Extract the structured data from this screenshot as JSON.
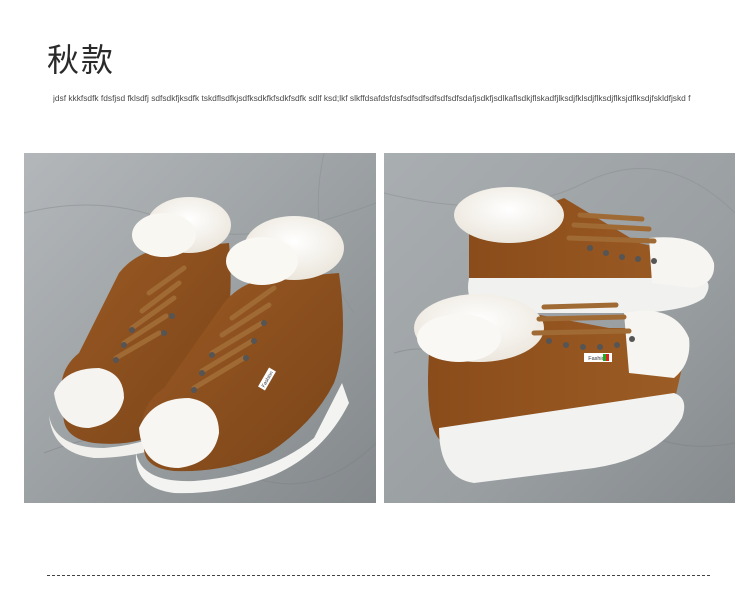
{
  "header": {
    "title": "秋款",
    "subtitle": "jdsf kkkfsdfk  fdsfjsd fklsdfj sdfsdkfjksdfk tskdflsdfkjsdfksdkfkfsdkfsdfk sdlf ksd;lkf slkffdsafdsfdsfsdfsdfsdfsdfsdfsdafjsdkfjsdlkaflsdkjflskadfjlksdjfklsdjflksdjflksjdflksdjfskldfjskd f"
  },
  "images": {
    "left": {
      "label": "front-pair-view",
      "tag_text": "Fashion"
    },
    "right": {
      "label": "side-pair-view",
      "tag_text": "Fashion"
    }
  },
  "colors": {
    "suede": "#8a4f1e",
    "fur": "#f6f2ea",
    "sole": "#f3f3f1",
    "background_concrete": "#9ea3a6"
  }
}
